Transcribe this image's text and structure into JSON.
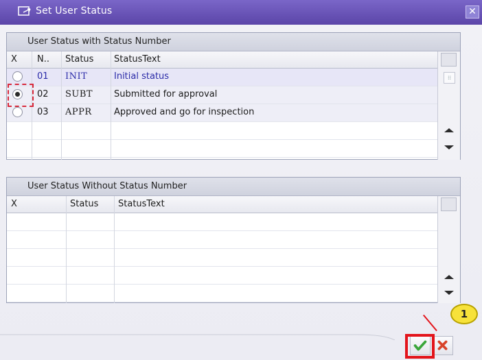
{
  "window": {
    "title": "Set User Status"
  },
  "panel1": {
    "title": "User Status with Status Number",
    "columns": [
      "X",
      "N..",
      "Status",
      "StatusText"
    ],
    "rows": [
      {
        "number": "01",
        "status": "INIT",
        "text": "Initial status",
        "selected": false
      },
      {
        "number": "02",
        "status": "SUBT",
        "text": "Submitted for approval",
        "selected": true
      },
      {
        "number": "03",
        "status": "APPR",
        "text": "Approved and go for inspection",
        "selected": false
      }
    ]
  },
  "panel2": {
    "title": "User Status Without Status Number",
    "columns": [
      "X",
      "Status",
      "StatusText"
    ]
  },
  "callout": {
    "number": "1"
  },
  "colors": {
    "title_bar": "#6b56bb",
    "callout_red": "#e3141b",
    "callout_yellow": "#f7e23a",
    "ok_green": "#3aa63a",
    "cancel_red": "#d8432a"
  }
}
